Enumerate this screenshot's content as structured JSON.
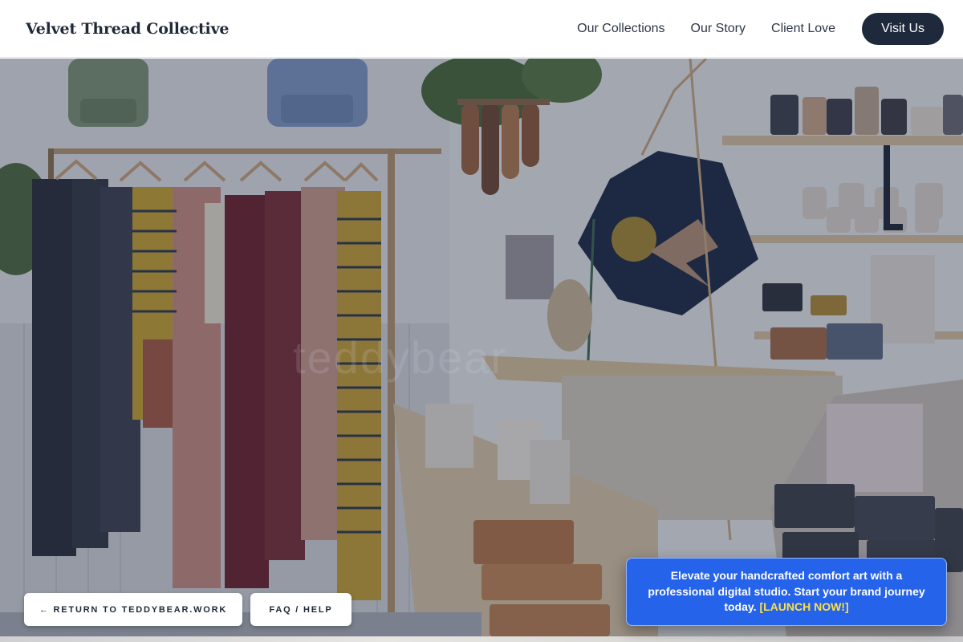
{
  "header": {
    "brand": "Velvet Thread Collective",
    "nav": [
      {
        "label": "Our Collections"
      },
      {
        "label": "Our Story"
      },
      {
        "label": "Client Love"
      }
    ],
    "cta_label": "Visit Us"
  },
  "hero": {
    "watermark": "teddybear"
  },
  "floating": {
    "return_label": "← RETURN TO TEDDYBEAR.WORK",
    "faq_label": "FAQ / HELP"
  },
  "promo": {
    "text": "Elevate your handcrafted comfort art with a professional digital studio. Start your brand journey today.",
    "link_label": "[LAUNCH NOW!]"
  },
  "colors": {
    "header_bg": "#ffffff",
    "cta_bg": "#1e293b",
    "promo_bg": "#2563eb",
    "promo_link": "#fde047"
  }
}
